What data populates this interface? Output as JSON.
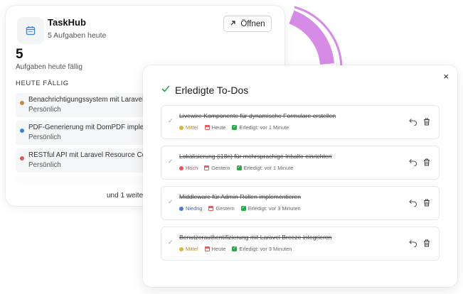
{
  "colors": {
    "accent_purple": "#d68be6",
    "check_green": "#2e9e52",
    "priority_medium": "#e0b33a",
    "priority_high": "#e15b5b",
    "priority_low": "#4a7ad8",
    "dot_orange": "#c98a3a",
    "dot_blue": "#3b82d6",
    "dot_red": "#e05858"
  },
  "widget": {
    "app_title": "TaskHub",
    "app_subtitle": "5 Aufgaben heute",
    "open_button": "Öffnen",
    "count": "5",
    "count_label": "Aufgaben heute fällig",
    "section_heading": "HEUTE FÄLLIG",
    "tasks": [
      {
        "title": "Benachrichtigungssystem mit Laravel N",
        "category": "Persönlich",
        "dot": "orange"
      },
      {
        "title": "PDF-Generierung mit DomPDF implemen",
        "category": "Persönlich",
        "dot": "blue"
      },
      {
        "title": "RESTful API mit Laravel Resource Contr",
        "category": "Persönlich",
        "dot": "red"
      }
    ],
    "more_text": "und 1 weitere"
  },
  "modal": {
    "title": "Erledigte To-Dos",
    "close_label": "×",
    "todos": [
      {
        "title": "Livewire-Komponente für dynamische Formulare erstellen",
        "priority": "Mittel",
        "priority_level": "medium",
        "date": "Heute",
        "completed": "Erledigt: vor 1 Minute"
      },
      {
        "title": "Lokalisierung (i18n) für mehrsprachige Inhalte einrichten",
        "priority": "Hoch",
        "priority_level": "high",
        "date": "Gestern",
        "completed": "Erledigt: vor 1 Minute"
      },
      {
        "title": "Middleware für Admin-Rollen implementieren",
        "priority": "Niedrig",
        "priority_level": "low",
        "date": "Gestern",
        "completed": "Erledigt: vor 3 Minuten"
      },
      {
        "title": "Benutzerauthentifizierung mit Laravel Breeze integrieren",
        "priority": "Mittel",
        "priority_level": "medium",
        "date": "Heute",
        "completed": "Erledigt: vor 3 Minuten"
      }
    ]
  }
}
